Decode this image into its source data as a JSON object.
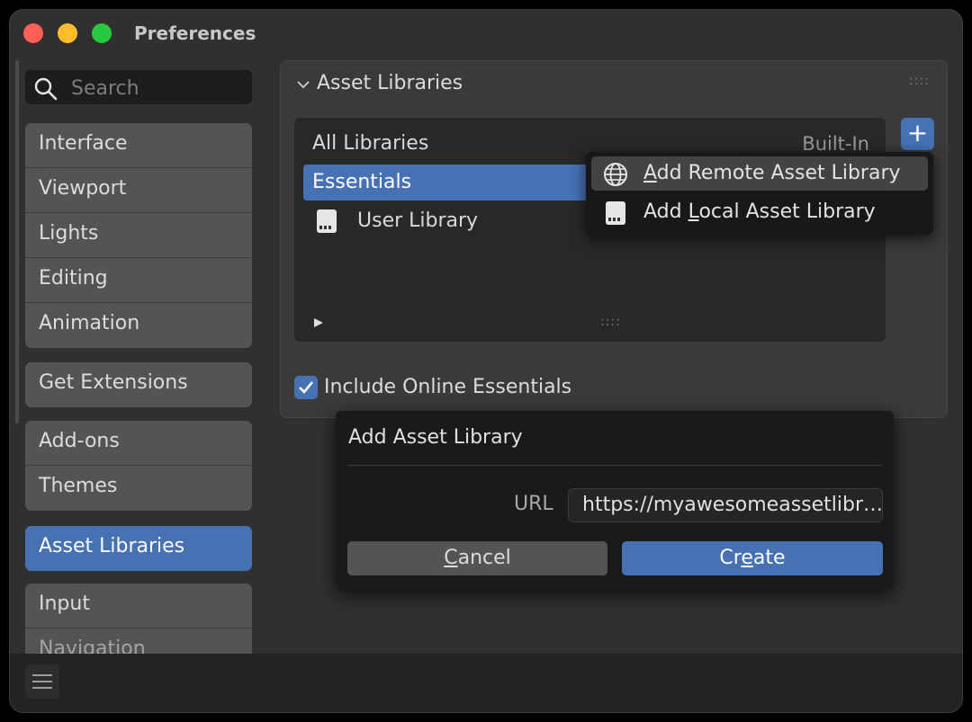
{
  "window": {
    "title": "Preferences"
  },
  "search": {
    "placeholder": "Search"
  },
  "sidebar": {
    "group1": [
      "Interface",
      "Viewport",
      "Lights",
      "Editing",
      "Animation"
    ],
    "group2": [
      "Get Extensions"
    ],
    "group3": [
      "Add-ons",
      "Themes"
    ],
    "group4": [
      "Asset Libraries"
    ],
    "group5": [
      "Input",
      "Navigation"
    ],
    "active": "Asset Libraries"
  },
  "panel": {
    "title": "Asset Libraries",
    "libraries": [
      {
        "name": "All Libraries",
        "tag": "Built-In"
      },
      {
        "name": "Essentials",
        "selected": true
      },
      {
        "name": "User Library",
        "icon": "disk-icon"
      }
    ],
    "checkbox": {
      "label": "Include Online Essentials",
      "checked": true
    }
  },
  "add_menu": {
    "items": [
      {
        "pre": "",
        "mn": "A",
        "post": "dd Remote Asset Library",
        "icon": "globe-icon"
      },
      {
        "pre": "Add ",
        "mn": "L",
        "post": "ocal Asset Library",
        "icon": "disk-icon"
      }
    ]
  },
  "dialog": {
    "title": "Add Asset Library",
    "url_label": "URL",
    "url_value": "https://myawesomeassetlibr…",
    "cancel": {
      "mn": "C",
      "post": "ancel"
    },
    "create": {
      "pre": "Cr",
      "mn": "e",
      "post": "ate"
    }
  },
  "colors": {
    "accent": "#4672b4",
    "window_bg": "#303030",
    "panel_bg": "#3a3a3a"
  }
}
